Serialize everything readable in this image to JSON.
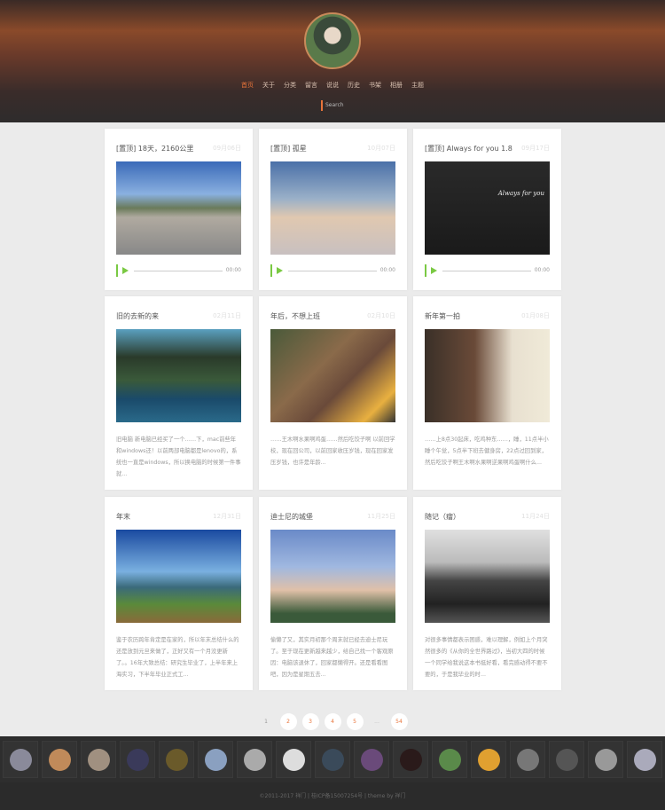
{
  "nav": {
    "items": [
      "首页",
      "关于",
      "分类",
      "留言",
      "说说",
      "历史",
      "书架",
      "相册",
      "主题"
    ],
    "active": 0,
    "search_placeholder": "Search"
  },
  "posts": [
    {
      "title": "[置顶] 18天，2160公里",
      "date": "09月06日",
      "audio_time": "00:00",
      "image": "road-hiker"
    },
    {
      "title": "[置顶] 孤星",
      "date": "10月07日",
      "audio_time": "00:00",
      "image": "sky-clouds"
    },
    {
      "title": "[置顶] Always for you 1.8",
      "date": "09月17日",
      "audio_time": "00:00",
      "image": "theme-devices",
      "image_caption": "Always for you"
    },
    {
      "title": "旧的去新的来",
      "date": "02月11日",
      "image": "lake-trees",
      "excerpt": "旧电脑 新电脑已经买了一个……下，mac前些年和windows还！以前两部电脑都是lenovo的，系统也一直是windows，所以换电脑的时候第一件事就..."
    },
    {
      "title": "年后，不想上班",
      "date": "02月10日",
      "image": "arm-floor",
      "excerpt": "……王木啊水果啊鸡蛋……然后吃饺子啊 以前回学校，现在回公司，以前回家收压岁钱，现在回家发压岁钱，也许是年龄..."
    },
    {
      "title": "新年第一拍",
      "date": "01月08日",
      "image": "portrait-room",
      "excerpt": "……上8点30起床，吃鸡种东……，睡，11点半小睡个午觉，5点半下班去健身房，22点过回到家，然后吃饺子啊王木啊水果啊逆果啊鸡蛋啊什么..."
    },
    {
      "title": "年末",
      "date": "12月31日",
      "image": "girl-lake",
      "excerpt": "鉴于农历跨年肯定是在家的，所以年末总结什么的还是放到元旦来做了，正好又有一个月没更新了。。16年大致总结：研究生毕业了，上半年来上海实习，下半年毕业正式工..."
    },
    {
      "title": "迪士尼的城堡",
      "date": "11月25日",
      "image": "castle",
      "excerpt": "偷懒了又，其实月初那个周末就已经去迪士尼玩了。至于现在更新越来越少，给自己找一个客观原因：电脑该退休了，回家都懒得开。还是看看图吧，因为是星期五去..."
    },
    {
      "title": "随记（瘤）",
      "date": "11月24日",
      "image": "bw-house",
      "excerpt": "对很多事情都表示困惑，难以理解，例如上个月突然很多的《从你的全世界路过》，当初大四的时候一个同学给我说这本书挺好看，看完感动得不要不要的，于是我毕业的时..."
    }
  ],
  "pagination": {
    "pages": [
      "1",
      "2",
      "3",
      "4",
      "5",
      "...",
      "54"
    ],
    "current": "1"
  },
  "friends_count": 17,
  "footer": {
    "text": "©2011-2017 祥门 | 桂ICP备15007254号 | theme by 祥门"
  },
  "colors": {
    "accent": "#e8743a",
    "player": "#7ac943",
    "footer_bg": "#2b2b2b"
  }
}
